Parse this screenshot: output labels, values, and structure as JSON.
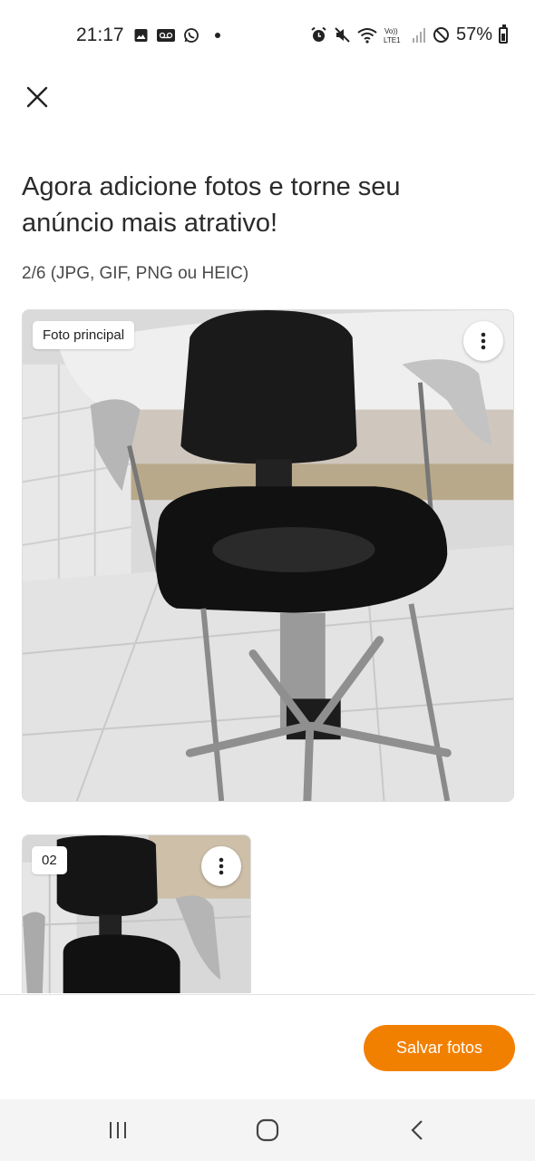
{
  "status_bar": {
    "time": "21:17",
    "battery": "57%",
    "battery_level": 0.57,
    "left_icons": [
      "gallery-icon",
      "voicemail-icon",
      "whatsapp-icon",
      "dot-icon"
    ],
    "right_icons": [
      "alarm-icon",
      "mute-icon",
      "wifi-icon",
      "volte-icon",
      "signal-icon",
      "dnd-icon",
      "battery-icon"
    ],
    "volte_text": "Vo))\nLTE1"
  },
  "header": {
    "close_icon": "close-icon"
  },
  "main": {
    "title": "Agora adicione fotos e torne seu anúncio mais atrativo!",
    "count_text": "2/6 (JPG, GIF, PNG ou HEIC)",
    "photos": [
      {
        "badge": "Foto principal",
        "menu_icon": "more-vertical-icon"
      },
      {
        "badge": "02",
        "menu_icon": "more-vertical-icon"
      }
    ]
  },
  "footer": {
    "save_label": "Salvar fotos",
    "accent_color": "#f28000"
  },
  "nav_bar": {
    "buttons": [
      "recent-apps-icon",
      "home-icon",
      "back-icon"
    ]
  }
}
